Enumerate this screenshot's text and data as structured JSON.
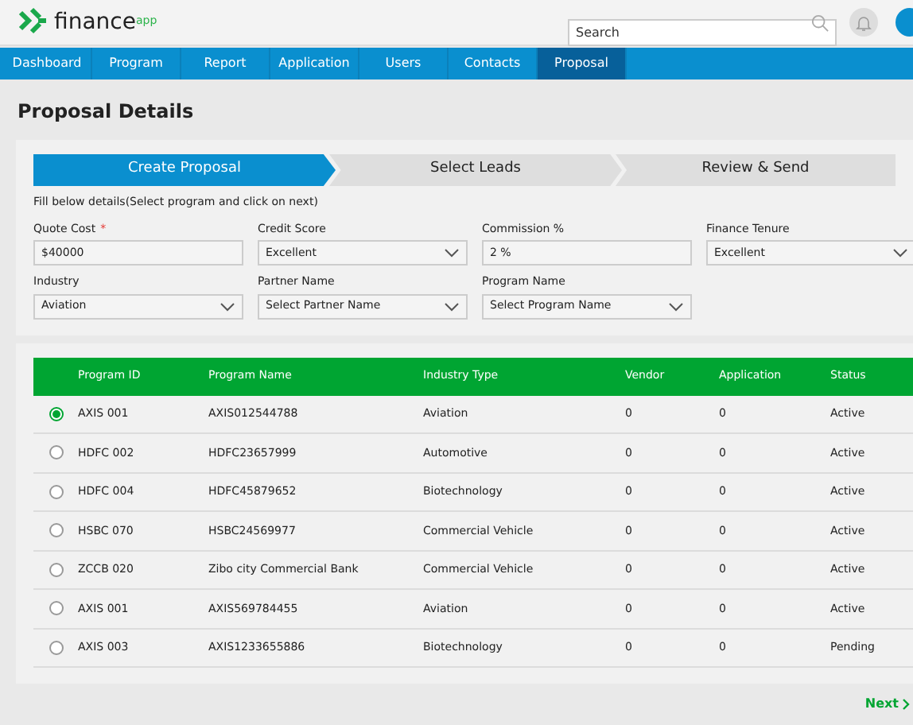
{
  "header": {
    "logo": {
      "name": "finance",
      "tag": "app"
    },
    "search": {
      "placeholder": "Search"
    }
  },
  "nav": [
    {
      "label": "Dashboard",
      "selected": false
    },
    {
      "label": "Program",
      "selected": false
    },
    {
      "label": "Report",
      "selected": false
    },
    {
      "label": "Application",
      "selected": false
    },
    {
      "label": "Users",
      "selected": false
    },
    {
      "label": "Contacts",
      "selected": false
    },
    {
      "label": "Proposal",
      "selected": true
    }
  ],
  "title": "Proposal Details",
  "steps": [
    {
      "label": "Create Proposal",
      "selected": true
    },
    {
      "label": "Select Leads",
      "selected": false
    },
    {
      "label": "Review & Send",
      "selected": false
    }
  ],
  "instructions": "Fill below details(Select program and click on next)",
  "fields": [
    {
      "kind": "text",
      "label": "Quote Cost",
      "required_mark": "*",
      "value": "$40000"
    },
    {
      "kind": "select",
      "label": "Credit Score",
      "value": "Excellent"
    },
    {
      "kind": "text",
      "label": "Commission %",
      "value": "2 %"
    },
    {
      "kind": "select",
      "label": "Finance Tenure",
      "value": "Excellent"
    },
    {
      "kind": "select",
      "label": "Industry",
      "value": "Aviation"
    },
    {
      "kind": "select",
      "label": "Partner Name",
      "value": "Select Partner Name"
    },
    {
      "kind": "select",
      "label": "Program Name",
      "value": "Select Program Name"
    }
  ],
  "table": {
    "columns": [
      "Program ID",
      "Program Name",
      "Industry Type",
      "Vendor",
      "Application",
      "Status"
    ],
    "rows": [
      {
        "selected": true,
        "cells": [
          "AXIS 001",
          "AXIS012544788",
          "Aviation",
          "0",
          "0",
          "Active"
        ]
      },
      {
        "selected": false,
        "cells": [
          "HDFC 002",
          "HDFC23657999",
          "Automotive",
          "0",
          "0",
          "Active"
        ]
      },
      {
        "selected": false,
        "cells": [
          "HDFC 004",
          "HDFC45879652",
          "Biotechnology",
          "0",
          "0",
          "Active"
        ]
      },
      {
        "selected": false,
        "cells": [
          "HSBC 070",
          "HSBC24569977",
          "Commercial Vehicle",
          "0",
          "0",
          "Active"
        ]
      },
      {
        "selected": false,
        "cells": [
          "ZCCB 020",
          "Zibo city Commercial Bank",
          "Commercial Vehicle",
          "0",
          "0",
          "Active"
        ]
      },
      {
        "selected": false,
        "cells": [
          "AXIS 001",
          "AXIS569784455",
          "Aviation",
          "0",
          "0",
          "Active"
        ]
      },
      {
        "selected": false,
        "cells": [
          "AXIS 003",
          "AXIS1233655886",
          "Biotechnology",
          "0",
          "0",
          "Pending"
        ]
      }
    ]
  },
  "next": "Next"
}
